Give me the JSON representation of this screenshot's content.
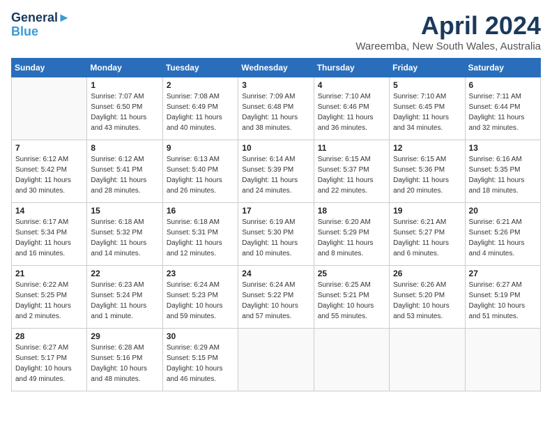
{
  "header": {
    "logo_line1": "General",
    "logo_line2": "Blue",
    "month": "April 2024",
    "location": "Wareemba, New South Wales, Australia"
  },
  "weekdays": [
    "Sunday",
    "Monday",
    "Tuesday",
    "Wednesday",
    "Thursday",
    "Friday",
    "Saturday"
  ],
  "weeks": [
    [
      {
        "day": "",
        "info": ""
      },
      {
        "day": "1",
        "info": "Sunrise: 7:07 AM\nSunset: 6:50 PM\nDaylight: 11 hours\nand 43 minutes."
      },
      {
        "day": "2",
        "info": "Sunrise: 7:08 AM\nSunset: 6:49 PM\nDaylight: 11 hours\nand 40 minutes."
      },
      {
        "day": "3",
        "info": "Sunrise: 7:09 AM\nSunset: 6:48 PM\nDaylight: 11 hours\nand 38 minutes."
      },
      {
        "day": "4",
        "info": "Sunrise: 7:10 AM\nSunset: 6:46 PM\nDaylight: 11 hours\nand 36 minutes."
      },
      {
        "day": "5",
        "info": "Sunrise: 7:10 AM\nSunset: 6:45 PM\nDaylight: 11 hours\nand 34 minutes."
      },
      {
        "day": "6",
        "info": "Sunrise: 7:11 AM\nSunset: 6:44 PM\nDaylight: 11 hours\nand 32 minutes."
      }
    ],
    [
      {
        "day": "7",
        "info": "Sunrise: 6:12 AM\nSunset: 5:42 PM\nDaylight: 11 hours\nand 30 minutes."
      },
      {
        "day": "8",
        "info": "Sunrise: 6:12 AM\nSunset: 5:41 PM\nDaylight: 11 hours\nand 28 minutes."
      },
      {
        "day": "9",
        "info": "Sunrise: 6:13 AM\nSunset: 5:40 PM\nDaylight: 11 hours\nand 26 minutes."
      },
      {
        "day": "10",
        "info": "Sunrise: 6:14 AM\nSunset: 5:39 PM\nDaylight: 11 hours\nand 24 minutes."
      },
      {
        "day": "11",
        "info": "Sunrise: 6:15 AM\nSunset: 5:37 PM\nDaylight: 11 hours\nand 22 minutes."
      },
      {
        "day": "12",
        "info": "Sunrise: 6:15 AM\nSunset: 5:36 PM\nDaylight: 11 hours\nand 20 minutes."
      },
      {
        "day": "13",
        "info": "Sunrise: 6:16 AM\nSunset: 5:35 PM\nDaylight: 11 hours\nand 18 minutes."
      }
    ],
    [
      {
        "day": "14",
        "info": "Sunrise: 6:17 AM\nSunset: 5:34 PM\nDaylight: 11 hours\nand 16 minutes."
      },
      {
        "day": "15",
        "info": "Sunrise: 6:18 AM\nSunset: 5:32 PM\nDaylight: 11 hours\nand 14 minutes."
      },
      {
        "day": "16",
        "info": "Sunrise: 6:18 AM\nSunset: 5:31 PM\nDaylight: 11 hours\nand 12 minutes."
      },
      {
        "day": "17",
        "info": "Sunrise: 6:19 AM\nSunset: 5:30 PM\nDaylight: 11 hours\nand 10 minutes."
      },
      {
        "day": "18",
        "info": "Sunrise: 6:20 AM\nSunset: 5:29 PM\nDaylight: 11 hours\nand 8 minutes."
      },
      {
        "day": "19",
        "info": "Sunrise: 6:21 AM\nSunset: 5:27 PM\nDaylight: 11 hours\nand 6 minutes."
      },
      {
        "day": "20",
        "info": "Sunrise: 6:21 AM\nSunset: 5:26 PM\nDaylight: 11 hours\nand 4 minutes."
      }
    ],
    [
      {
        "day": "21",
        "info": "Sunrise: 6:22 AM\nSunset: 5:25 PM\nDaylight: 11 hours\nand 2 minutes."
      },
      {
        "day": "22",
        "info": "Sunrise: 6:23 AM\nSunset: 5:24 PM\nDaylight: 11 hours\nand 1 minute."
      },
      {
        "day": "23",
        "info": "Sunrise: 6:24 AM\nSunset: 5:23 PM\nDaylight: 10 hours\nand 59 minutes."
      },
      {
        "day": "24",
        "info": "Sunrise: 6:24 AM\nSunset: 5:22 PM\nDaylight: 10 hours\nand 57 minutes."
      },
      {
        "day": "25",
        "info": "Sunrise: 6:25 AM\nSunset: 5:21 PM\nDaylight: 10 hours\nand 55 minutes."
      },
      {
        "day": "26",
        "info": "Sunrise: 6:26 AM\nSunset: 5:20 PM\nDaylight: 10 hours\nand 53 minutes."
      },
      {
        "day": "27",
        "info": "Sunrise: 6:27 AM\nSunset: 5:19 PM\nDaylight: 10 hours\nand 51 minutes."
      }
    ],
    [
      {
        "day": "28",
        "info": "Sunrise: 6:27 AM\nSunset: 5:17 PM\nDaylight: 10 hours\nand 49 minutes."
      },
      {
        "day": "29",
        "info": "Sunrise: 6:28 AM\nSunset: 5:16 PM\nDaylight: 10 hours\nand 48 minutes."
      },
      {
        "day": "30",
        "info": "Sunrise: 6:29 AM\nSunset: 5:15 PM\nDaylight: 10 hours\nand 46 minutes."
      },
      {
        "day": "",
        "info": ""
      },
      {
        "day": "",
        "info": ""
      },
      {
        "day": "",
        "info": ""
      },
      {
        "day": "",
        "info": ""
      }
    ]
  ]
}
